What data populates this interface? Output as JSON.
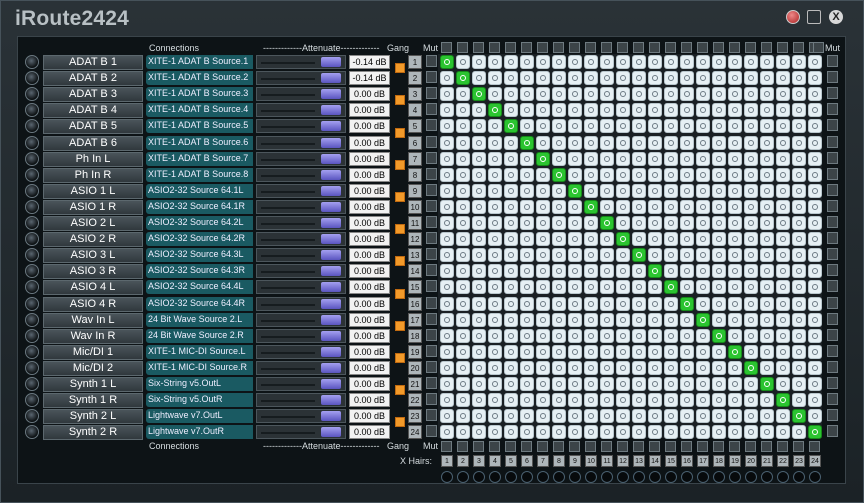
{
  "window": {
    "title": "iRoute2424",
    "close_glyph": "X"
  },
  "headers": {
    "connections_top": "Connections",
    "attenuate_top": "-------------Attenuate-------------",
    "gang_top": "Gang",
    "mute_top_left": "Mut",
    "mute_top_right": "Mut",
    "connections_bottom": "Connections",
    "attenuate_bottom": "-------------Attenuate-------------",
    "gang_bottom": "Gang",
    "mute_bottom": "Mut",
    "xhairs_label": "X Hairs:"
  },
  "channels": [
    {
      "num": "1",
      "name": "ADAT B 1",
      "source": "XITE-1 ADAT B Source.1",
      "atten": "-0.14 dB"
    },
    {
      "num": "2",
      "name": "ADAT B 2",
      "source": "XITE-1 ADAT B Source.2",
      "atten": "-0.14 dB"
    },
    {
      "num": "3",
      "name": "ADAT B 3",
      "source": "XITE-1 ADAT B Source.3",
      "atten": "0.00 dB"
    },
    {
      "num": "4",
      "name": "ADAT B 4",
      "source": "XITE-1 ADAT B Source.4",
      "atten": "0.00 dB"
    },
    {
      "num": "5",
      "name": "ADAT B 5",
      "source": "XITE-1 ADAT B Source.5",
      "atten": "0.00 dB"
    },
    {
      "num": "6",
      "name": "ADAT B 6",
      "source": "XITE-1 ADAT B Source.6",
      "atten": "0.00 dB"
    },
    {
      "num": "7",
      "name": "Ph In L",
      "source": "XITE-1 ADAT B Source.7",
      "atten": "0.00 dB"
    },
    {
      "num": "8",
      "name": "Ph In R",
      "source": "XITE-1 ADAT B Source.8",
      "atten": "0.00 dB"
    },
    {
      "num": "9",
      "name": "ASIO 1 L",
      "source": "ASIO2-32 Source 64.1L",
      "atten": "0.00 dB"
    },
    {
      "num": "10",
      "name": "ASIO 1 R",
      "source": "ASIO2-32 Source 64.1R",
      "atten": "0.00 dB"
    },
    {
      "num": "11",
      "name": "ASIO 2 L",
      "source": "ASIO2-32 Source 64.2L",
      "atten": "0.00 dB"
    },
    {
      "num": "12",
      "name": "ASIO 2 R",
      "source": "ASIO2-32 Source 64.2R",
      "atten": "0.00 dB"
    },
    {
      "num": "13",
      "name": "ASIO 3 L",
      "source": "ASIO2-32 Source 64.3L",
      "atten": "0.00 dB"
    },
    {
      "num": "14",
      "name": "ASIO 3 R",
      "source": "ASIO2-32 Source 64.3R",
      "atten": "0.00 dB"
    },
    {
      "num": "15",
      "name": "ASIO 4 L",
      "source": "ASIO2-32 Source 64.4L",
      "atten": "0.00 dB"
    },
    {
      "num": "16",
      "name": "ASIO 4 R",
      "source": "ASIO2-32 Source 64.4R",
      "atten": "0.00 dB"
    },
    {
      "num": "17",
      "name": "Wav In  L",
      "source": "24 Bit Wave Source 2.L",
      "atten": "0.00 dB"
    },
    {
      "num": "18",
      "name": "Wav In R",
      "source": "24 Bit Wave Source 2.R",
      "atten": "0.00 dB"
    },
    {
      "num": "19",
      "name": "Mic/DI 1",
      "source": "XITE-1 MIC-DI Source.L",
      "atten": "0.00 dB"
    },
    {
      "num": "20",
      "name": "Mic/DI 2",
      "source": "XITE-1 MIC-DI Source.R",
      "atten": "0.00 dB"
    },
    {
      "num": "21",
      "name": "Synth 1 L",
      "source": "Six-String v5.OutL",
      "atten": "0.00 dB"
    },
    {
      "num": "22",
      "name": "Synth 1 R",
      "source": "Six-String v5.OutR",
      "atten": "0.00 dB"
    },
    {
      "num": "23",
      "name": "Synth 2 L",
      "source": "Lightwave v7.OutL",
      "atten": "0.00 dB"
    },
    {
      "num": "24",
      "name": "Synth 2 R",
      "source": "Lightwave v7.OutR",
      "atten": "0.00 dB"
    }
  ],
  "gang_rows": [
    1,
    3,
    5,
    7,
    9,
    11,
    13,
    15,
    17,
    19,
    21,
    23
  ],
  "matrix": {
    "size": 24,
    "active": [
      [
        1,
        1
      ],
      [
        2,
        2
      ],
      [
        3,
        3
      ],
      [
        4,
        4
      ],
      [
        5,
        5
      ],
      [
        6,
        6
      ],
      [
        7,
        7
      ],
      [
        8,
        8
      ],
      [
        9,
        9
      ],
      [
        10,
        10
      ],
      [
        11,
        11
      ],
      [
        12,
        12
      ],
      [
        13,
        13
      ],
      [
        14,
        14
      ],
      [
        15,
        15
      ],
      [
        16,
        16
      ],
      [
        17,
        17
      ],
      [
        18,
        18
      ],
      [
        19,
        19
      ],
      [
        20,
        20
      ],
      [
        21,
        21
      ],
      [
        22,
        22
      ],
      [
        23,
        23
      ],
      [
        24,
        24
      ]
    ]
  },
  "xhairs": [
    "1",
    "2",
    "3",
    "4",
    "5",
    "6",
    "7",
    "8",
    "9",
    "10",
    "11",
    "12",
    "13",
    "14",
    "15",
    "16",
    "17",
    "18",
    "19",
    "20",
    "21",
    "22",
    "23",
    "24"
  ],
  "icons": {
    "power": "power-icon",
    "minimize": "minimize-icon",
    "restore": "restore-icon",
    "close": "close-icon"
  }
}
